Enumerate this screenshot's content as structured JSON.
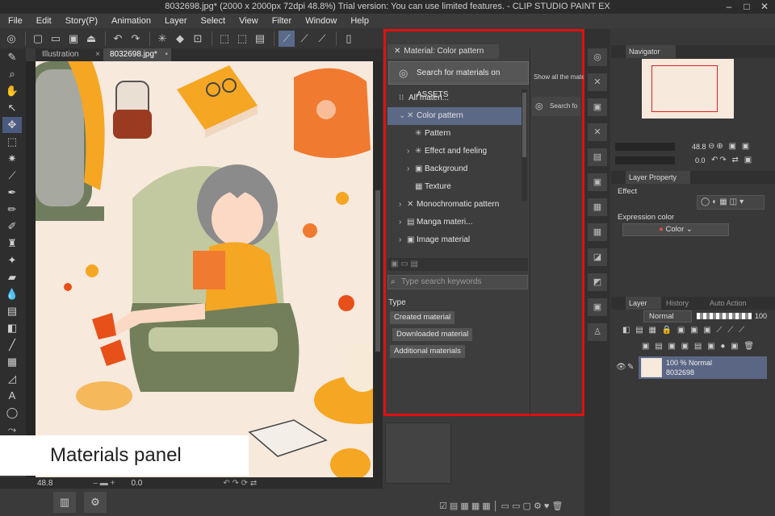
{
  "app": {
    "title": "8032698.jpg* (2000 x 2000px 72dpi 48.8%)  Trial version: You can use limited features. - CLIP STUDIO PAINT EX"
  },
  "menu": [
    "File",
    "Edit",
    "Story(P)",
    "Animation",
    "Layer",
    "Select",
    "View",
    "Filter",
    "Window",
    "Help"
  ],
  "canvas_tabs": [
    {
      "label": "Illustration"
    },
    {
      "label": "8032698.jpg*"
    }
  ],
  "caption": "Materials panel",
  "status": {
    "zoom": "48.8",
    "angle": "0.0"
  },
  "material_panel": {
    "header": "Material: Color pattern",
    "assets_button": "Search for materials on ASSETS",
    "show_all": "Show all the mate",
    "search_for": "Search fo",
    "tree": [
      {
        "label": "All materi...",
        "level": 0,
        "chev": "",
        "icon": "⁝⁝"
      },
      {
        "label": "Color pattern",
        "level": 1,
        "chev": "⌄",
        "icon": "✕",
        "selected": true
      },
      {
        "label": "Pattern",
        "level": 2,
        "chev": "",
        "icon": "✳"
      },
      {
        "label": "Effect and feeling",
        "level": 2,
        "chev": "›",
        "icon": "✳"
      },
      {
        "label": "Background",
        "level": 2,
        "chev": "›",
        "icon": "▣"
      },
      {
        "label": "Texture",
        "level": 2,
        "chev": "",
        "icon": "▦"
      },
      {
        "label": "Monochromatic pattern",
        "level": 1,
        "chev": "›",
        "icon": "✕"
      },
      {
        "label": "Manga materi...",
        "level": 1,
        "chev": "›",
        "icon": "▤"
      },
      {
        "label": "Image material",
        "level": 1,
        "chev": "›",
        "icon": "▣"
      }
    ],
    "search_placeholder": "Type search keywords",
    "type_label": "Type",
    "type_buttons": [
      "Created material",
      "Downloaded material",
      "Additional materials"
    ]
  },
  "navigator": {
    "tab": "Navigator",
    "zoom": "48.8",
    "angle": "0.0"
  },
  "layer_property": {
    "tab": "Layer Property",
    "effect_label": "Effect",
    "expression_label": "Expression color",
    "expression_value": "Color"
  },
  "layer_panel": {
    "tabs": [
      "Layer",
      "History",
      "Auto Action"
    ],
    "blend_mode": "Normal",
    "opacity": "100",
    "layer_line1": "100 % Normal",
    "layer_line2": "8032698"
  }
}
